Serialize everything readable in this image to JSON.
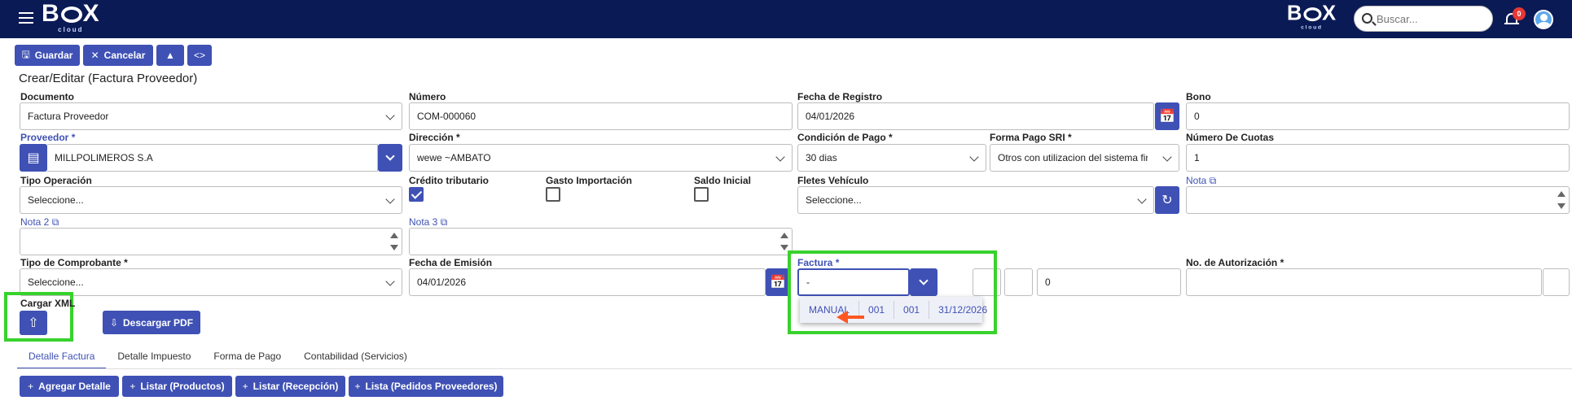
{
  "header": {
    "logo_main": "B",
    "logo_end": "X",
    "logo_sub": "cloud",
    "logo2_main": "B",
    "logo2_end": "X",
    "logo2_sub": "cloud",
    "search_placeholder": "Buscar...",
    "notifications_count": "0",
    "icons": {
      "menu": "hamburger-icon",
      "search": "search-icon",
      "bell": "bell-icon",
      "user": "user-avatar-icon"
    }
  },
  "toolbar": {
    "save_label": "Guardar",
    "cancel_label": "Cancelar",
    "icons": {
      "save": "floppy-icon",
      "cancel": "close-icon",
      "bank": "bank-icon",
      "code": "code-icon"
    }
  },
  "page_title": "Crear/Editar (Factura Proveedor)",
  "form": {
    "documento": {
      "label": "Documento",
      "value": "Factura Proveedor"
    },
    "numero": {
      "label": "Número",
      "value": "COM-000060"
    },
    "fecha_registro": {
      "label": "Fecha de Registro",
      "value": "04/01/2026"
    },
    "bono": {
      "label": "Bono",
      "value": "0"
    },
    "proveedor": {
      "label": "Proveedor",
      "required": "*",
      "value": "MILLPOLIMEROS S.A"
    },
    "direccion": {
      "label": "Dirección",
      "required": "*",
      "value": "wewe ~AMBATO"
    },
    "condicion_pago": {
      "label": "Condición de Pago",
      "required": "*",
      "value": "30 dias"
    },
    "forma_pago_sri": {
      "label": "Forma Pago SRI",
      "required": "*",
      "value": "Otros con utilizacion del sistema fin"
    },
    "numero_cuotas": {
      "label": "Número De Cuotas",
      "value": "1"
    },
    "tipo_operacion": {
      "label": "Tipo Operación",
      "value": "Seleccione..."
    },
    "credito_tributario": {
      "label": "Crédito tributario",
      "checked": true
    },
    "gasto_importacion": {
      "label": "Gasto Importación",
      "checked": false
    },
    "saldo_inicial": {
      "label": "Saldo Inicial",
      "checked": false
    },
    "fletes_vehiculo": {
      "label": "Fletes Vehículo",
      "value": "Seleccione..."
    },
    "nota": {
      "label": "Nota",
      "value": ""
    },
    "nota2": {
      "label": "Nota 2",
      "value": ""
    },
    "nota3": {
      "label": "Nota 3",
      "value": ""
    },
    "tipo_comprobante": {
      "label": "Tipo de Comprobante",
      "required": "*",
      "value": "Seleccione..."
    },
    "fecha_emision": {
      "label": "Fecha de Emisión",
      "value": "04/01/2026"
    },
    "factura": {
      "label": "Factura",
      "required": "*",
      "value": "-"
    },
    "factura_num": {
      "value": "0"
    },
    "no_autorizacion": {
      "label": "No. de Autorización",
      "required": "*",
      "value": ""
    },
    "factura_suggestions": [
      "MANUAL",
      "001",
      "001",
      "31/12/2026"
    ]
  },
  "xml": {
    "label": "Cargar XML",
    "download_label": "Descargar PDF"
  },
  "tabs": [
    {
      "label": "Detalle Factura",
      "active": true
    },
    {
      "label": "Detalle Impuesto"
    },
    {
      "label": "Forma de Pago"
    },
    {
      "label": "Contabilidad (Servicios)"
    }
  ],
  "detail_buttons": [
    "Agregar Detalle",
    "Listar (Productos)",
    "Listar (Recepción)",
    "Lista (Pedidos Proveedores)"
  ],
  "colors": {
    "header_bg": "#0a1a55",
    "primary": "#3f51b5",
    "highlight": "#38d22c",
    "arrow": "#ff5722",
    "badge": "#e53935"
  }
}
